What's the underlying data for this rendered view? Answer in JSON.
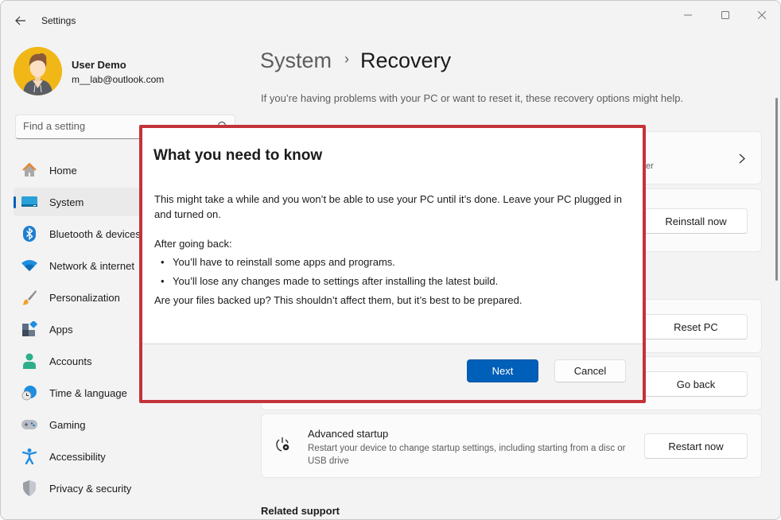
{
  "window": {
    "app_title": "Settings",
    "controls": {
      "minimize": "minimize-icon",
      "maximize": "maximize-icon",
      "close": "close-icon"
    }
  },
  "profile": {
    "name": "User Demo",
    "email": "m__lab@outlook.com"
  },
  "search": {
    "placeholder": "Find a setting",
    "value": ""
  },
  "sidebar": {
    "items": [
      {
        "label": "Home",
        "icon": "home-icon",
        "active": false
      },
      {
        "label": "System",
        "icon": "system-icon",
        "active": true
      },
      {
        "label": "Bluetooth & devices",
        "icon": "bluetooth-icon",
        "active": false
      },
      {
        "label": "Network & internet",
        "icon": "wifi-icon",
        "active": false
      },
      {
        "label": "Personalization",
        "icon": "brush-icon",
        "active": false
      },
      {
        "label": "Apps",
        "icon": "apps-icon",
        "active": false
      },
      {
        "label": "Accounts",
        "icon": "accounts-icon",
        "active": false
      },
      {
        "label": "Time & language",
        "icon": "globe-clock-icon",
        "active": false
      },
      {
        "label": "Gaming",
        "icon": "gamepad-icon",
        "active": false
      },
      {
        "label": "Accessibility",
        "icon": "accessibility-icon",
        "active": false
      },
      {
        "label": "Privacy & security",
        "icon": "shield-icon",
        "active": false
      }
    ]
  },
  "main": {
    "breadcrumb": {
      "parent": "System",
      "separator": "›",
      "current": "Recovery"
    },
    "subtitle": "If you’re having problems with your PC or want to reset it, these recovery options might help.",
    "cards": {
      "fix_problems": {
        "sub_fragment": "ter"
      },
      "reinstall": {
        "button": "Reinstall now"
      },
      "reset": {
        "button": "Reset PC"
      },
      "go_back": {
        "button": "Go back"
      },
      "advanced_startup": {
        "title": "Advanced startup",
        "description": "Restart your device to change startup settings, including starting from a disc or USB drive",
        "button": "Restart now"
      }
    },
    "related_support": "Related support"
  },
  "dialog": {
    "title": "What you need to know",
    "paragraph1": "This might take a while and you won’t be able to use your PC until it’s done. Leave your PC plugged in and turned on.",
    "list_heading": "After going back:",
    "bullets": [
      "You’ll have to reinstall some apps and programs.",
      "You’ll lose any changes made to settings after installing the latest build."
    ],
    "closing": "Are your files backed up? This shouldn’t affect them, but it’s best to be prepared.",
    "primary_button": "Next",
    "secondary_button": "Cancel",
    "highlight_color": "#c4323a",
    "accent_color": "#005fb8"
  }
}
